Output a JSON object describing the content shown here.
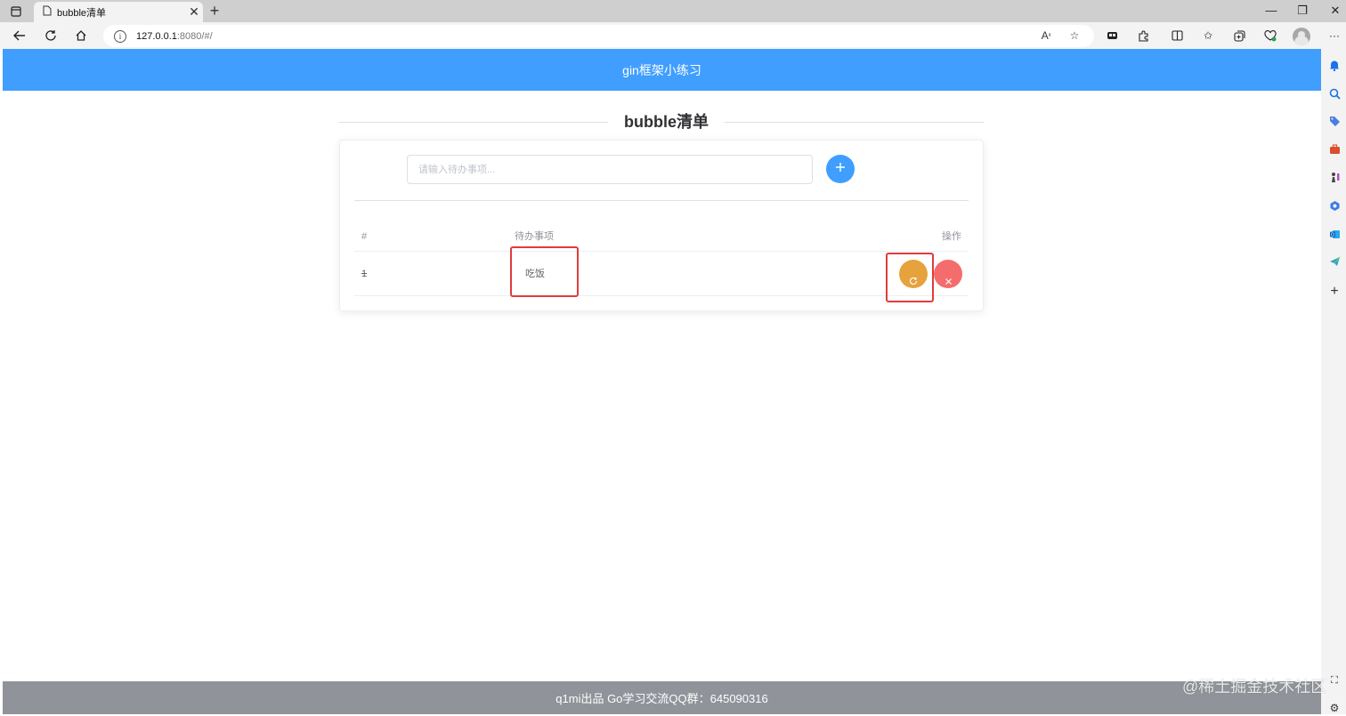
{
  "browser": {
    "tab_title": "bubble清单",
    "url_host": "127.0.0.1",
    "url_rest": ":8080/#/",
    "icons": [
      "tab-actions-icon",
      "page-icon",
      "close-tab-icon",
      "new-tab-icon",
      "minimize-icon",
      "restore-icon",
      "close-window-icon",
      "back-icon",
      "refresh-icon",
      "home-icon",
      "site-info-icon",
      "read-aloud-icon",
      "favorite-icon",
      "extensions-icon",
      "split-screen-icon",
      "favorites-icon",
      "collections-icon",
      "performance-icon",
      "profile-avatar",
      "more-icon"
    ]
  },
  "sidebar_icons": [
    "bell-icon",
    "search-icon",
    "tag-icon",
    "briefcase-icon",
    "chess-icon",
    "copilot-icon",
    "outlook-icon",
    "telegram-icon",
    "add-icon"
  ],
  "header": {
    "title": "gin框架小练习"
  },
  "main": {
    "section_title": "bubble清单",
    "input_placeholder": "请输入待办事项...",
    "table": {
      "headers": {
        "id": "#",
        "item": "待办事项",
        "op": "操作"
      },
      "rows": [
        {
          "id": "1",
          "item": "吃饭"
        }
      ]
    }
  },
  "footer": {
    "text": "q1mi出品 Go学习交流QQ群：645090316"
  },
  "watermark": "@稀土掘金技术社区",
  "colors": {
    "primary": "#409eff",
    "warning": "#e6a23c",
    "danger": "#f56c6c",
    "footer": "#909399",
    "highlight": "#e03c3c"
  }
}
